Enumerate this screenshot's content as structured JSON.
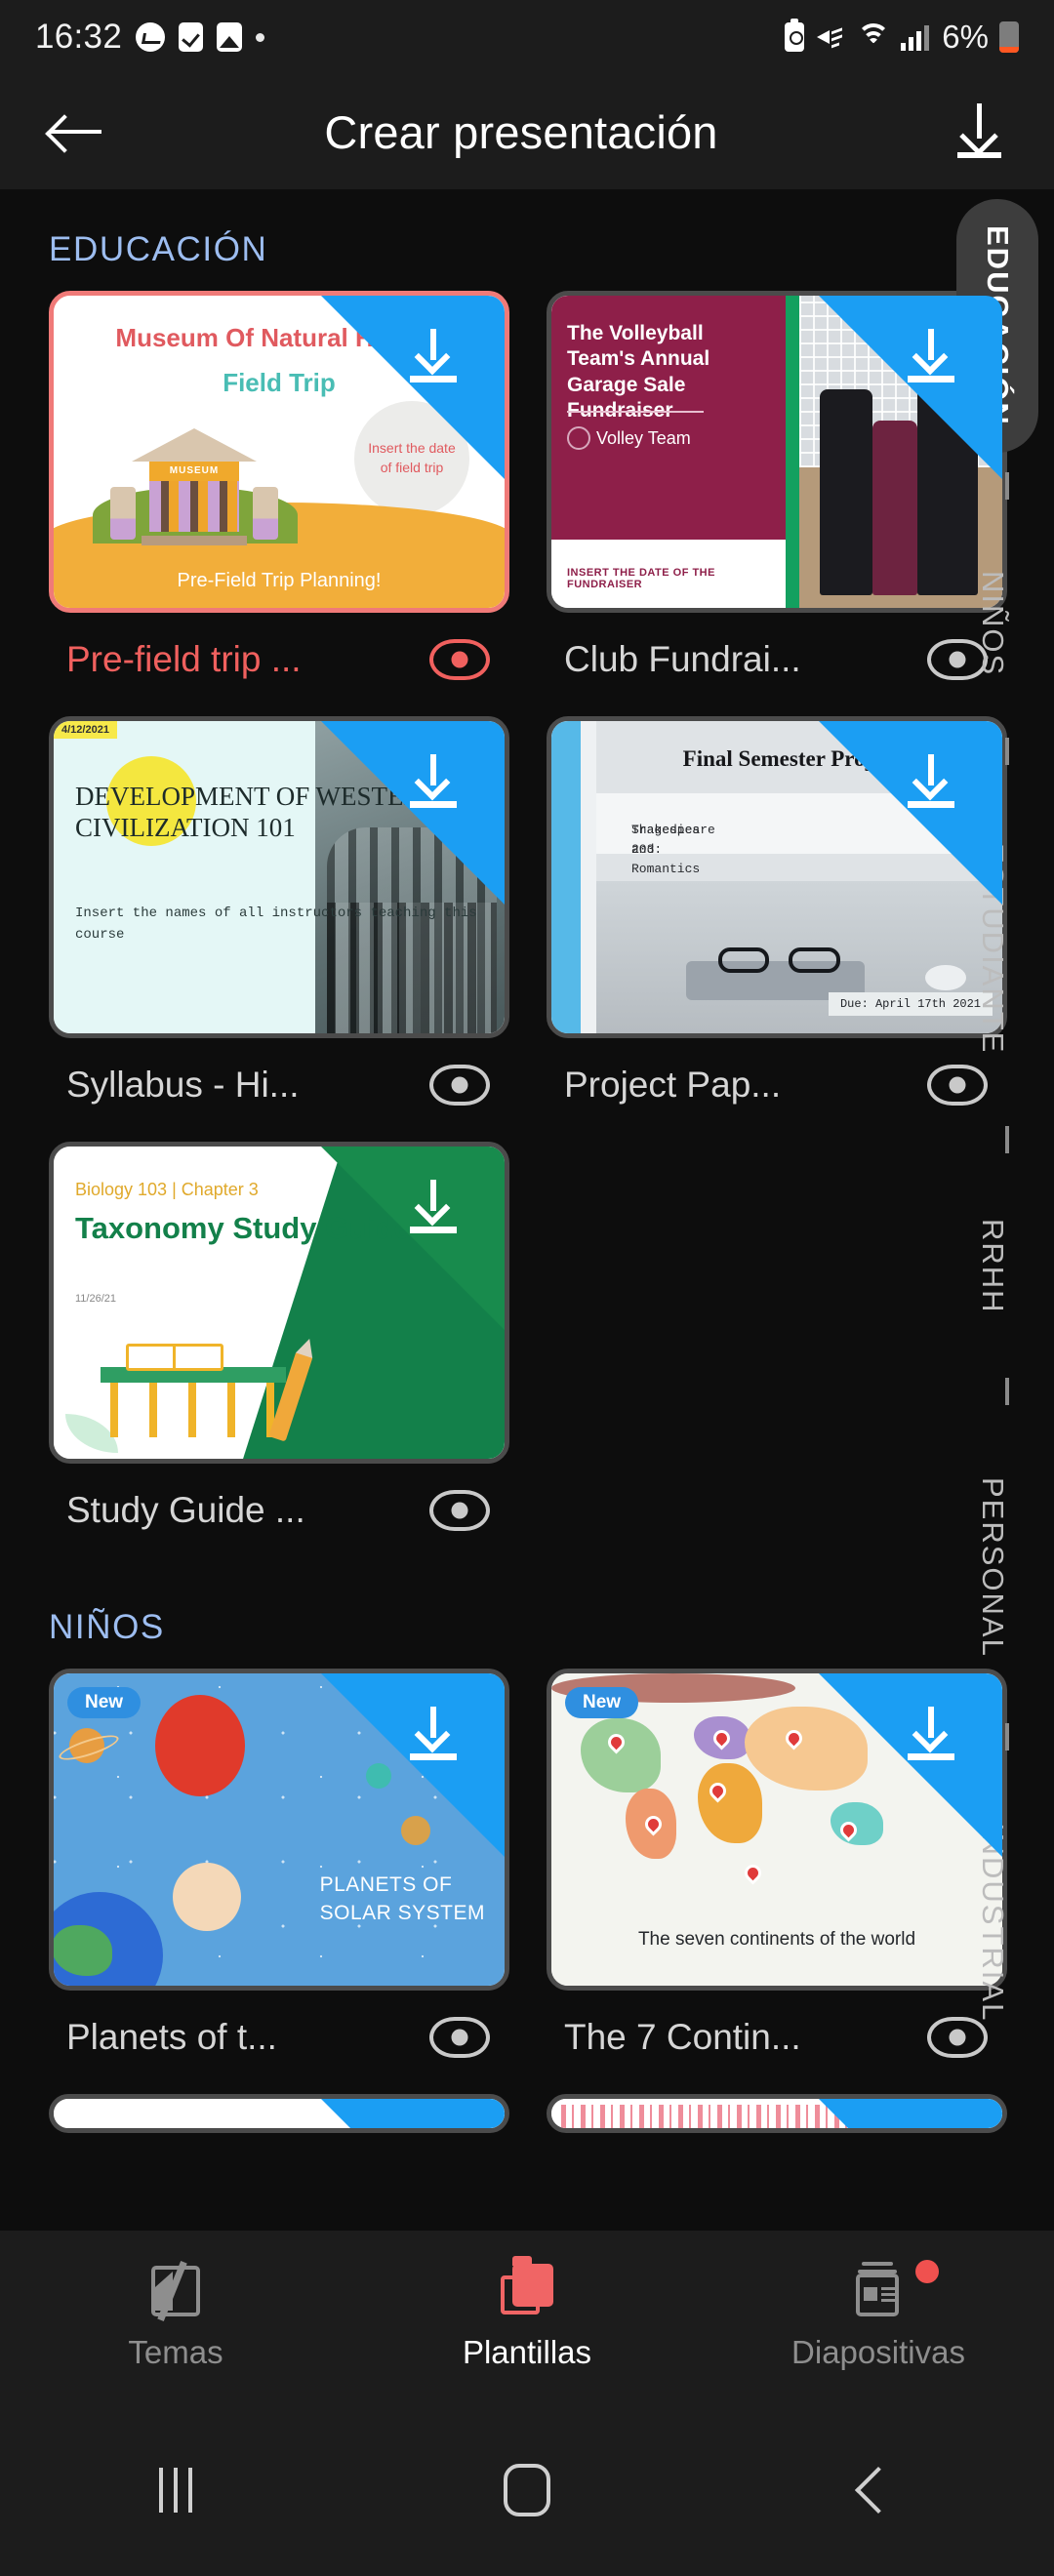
{
  "status_bar": {
    "time": "16:32",
    "battery_percent": "6%",
    "left_icons": [
      "messenger-icon",
      "checkbox-icon",
      "photo-icon",
      "dot-icon"
    ],
    "right_icons": [
      "battery-saver-icon",
      "mute-icon",
      "wifi-icon",
      "signal-icon",
      "battery-icon"
    ]
  },
  "app_bar": {
    "back_icon": "back-arrow-icon",
    "title": "Crear presentación",
    "download_icon": "download-icon"
  },
  "sections": [
    {
      "title": "EDUCACIÓN",
      "cards": [
        {
          "label": "Pre-field trip ...",
          "selected": true,
          "badge": "",
          "slide": {
            "title_line1": "Museum Of Natural History",
            "title_line2": "Field Trip",
            "circle_text": "Insert the date of field trip",
            "footer": "Pre-Field Trip Planning!",
            "banner": "MUSEUM"
          }
        },
        {
          "label": "Club Fundrai...",
          "selected": false,
          "badge": "",
          "slide": {
            "title": "The Volleyball Team's Annual Garage Sale Fundraiser",
            "team": "Volley Team",
            "insert": "INSERT THE DATE OF THE FUNDRAISER"
          }
        },
        {
          "label": "Syllabus - Hi...",
          "selected": false,
          "badge": "",
          "slide": {
            "date_tag": "4/12/2021",
            "title": "DEVELOPMENT OF WESTERN CIVILIZATION 101",
            "subtitle": "Insert the names of all instructors teaching this course"
          }
        },
        {
          "label": "Project Pap...",
          "selected": false,
          "badge": "",
          "slide": {
            "title": "Final Semester Project",
            "course": "Shakespeare 203:",
            "course2": "Tragedies and Romantics",
            "due": "Due: April 17th 2021"
          }
        },
        {
          "label": "Study Guide ...",
          "selected": false,
          "badge": "",
          "slide": {
            "kicker": "Biology 103 | Chapter 3",
            "title": "Taxonomy Study Guide V1",
            "date": "11/26/21"
          }
        }
      ]
    },
    {
      "title": "NIÑOS",
      "cards": [
        {
          "label": "Planets of t...",
          "selected": false,
          "badge": "New",
          "slide": {
            "title_line1": "PLANETS OF",
            "title_line2": "SOLAR SYSTEM"
          }
        },
        {
          "label": "The 7 Contin...",
          "selected": false,
          "badge": "New",
          "slide": {
            "caption": "The seven continents of the world"
          }
        }
      ]
    }
  ],
  "index_rail": {
    "items": [
      "EDUCACIÓN",
      "NIÑOS",
      "ESTUDIANTE",
      "RRHH",
      "PERSONAL",
      "INDUSTRIAL"
    ],
    "active": "EDUCACIÓN"
  },
  "bottom_nav": {
    "items": [
      {
        "label": "Temas",
        "icon": "themes-icon",
        "active": false,
        "badge": false
      },
      {
        "label": "Plantillas",
        "icon": "templates-folder-icon",
        "active": true,
        "badge": false
      },
      {
        "label": "Diapositivas",
        "icon": "slides-icon",
        "active": false,
        "badge": true
      }
    ]
  },
  "android_nav": {
    "recents_icon": "recents-icon",
    "home_icon": "home-icon",
    "back_icon": "back-icon"
  },
  "colors": {
    "accent_red": "#f0605e",
    "section_header": "#9dbdf0",
    "download_corner": "#1b9ef3",
    "background": "#0d0d0d",
    "bar_background": "#1c1c1c"
  }
}
